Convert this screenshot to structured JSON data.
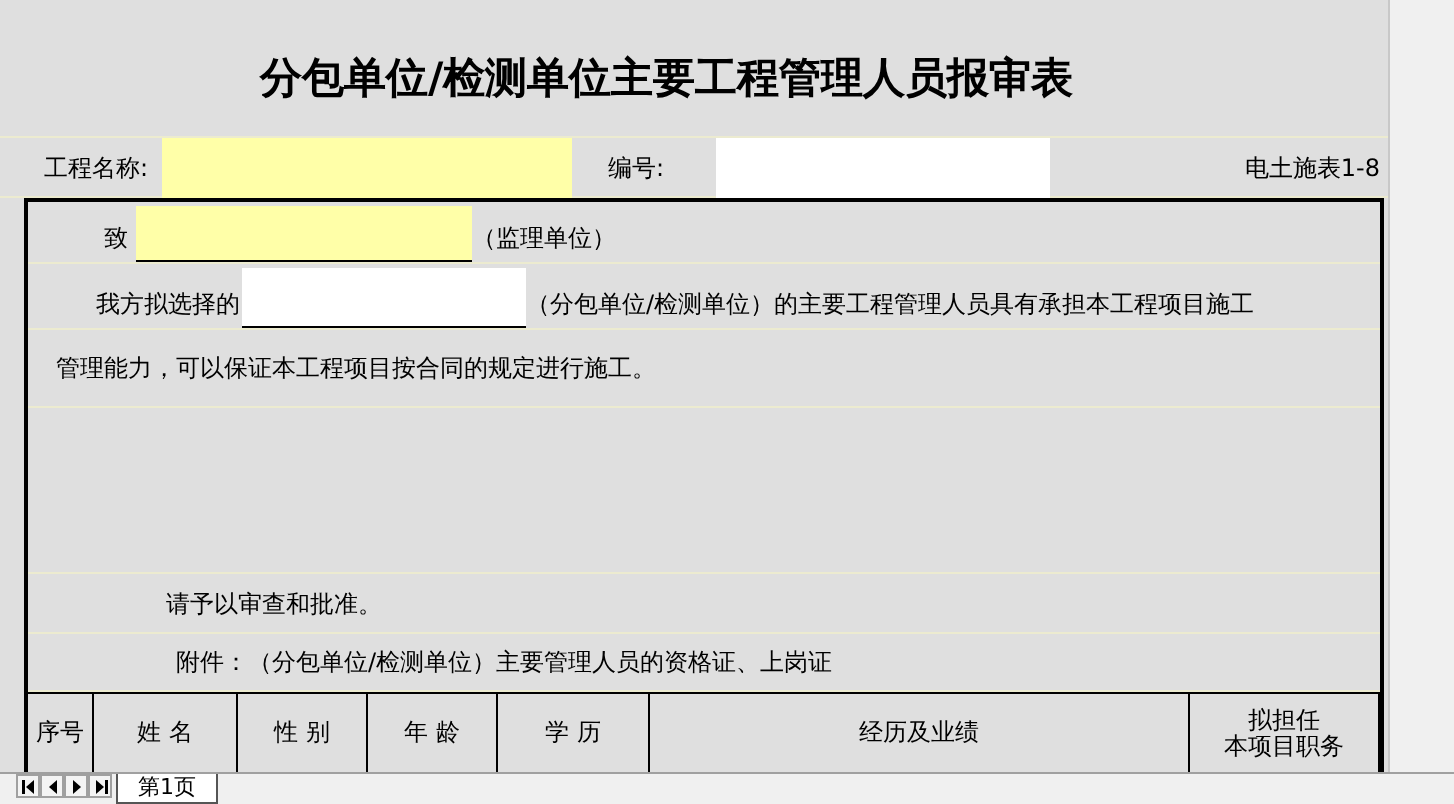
{
  "title": "分包单位/检测单位主要工程管理人员报审表",
  "header": {
    "project_label": "工程名称:",
    "number_label": "编号:",
    "form_code": "电土施表1-8"
  },
  "body": {
    "to_label": "致",
    "to_suffix": "（监理单位）",
    "line1_prefix": "我方拟选择的",
    "line1_suffix": "（分包单位/检测单位）的主要工程管理人员具有承担本工程项目施工",
    "line2": "管理能力，可以保证本工程项目按合同的规定进行施工。",
    "request": "请予以审查和批准。",
    "attachment": "附件：（分包单位/检测单位）主要管理人员的资格证、上岗证"
  },
  "table": {
    "columns": [
      {
        "lines": [
          "序号"
        ]
      },
      {
        "lines": [
          "姓 名"
        ]
      },
      {
        "lines": [
          "性 别"
        ]
      },
      {
        "lines": [
          "年 龄"
        ]
      },
      {
        "lines": [
          "学 历"
        ]
      },
      {
        "lines": [
          "经历及业绩"
        ]
      },
      {
        "lines": [
          "拟担任",
          "本项目职务"
        ]
      }
    ]
  },
  "sheet_tabs": [
    {
      "label": "第1页",
      "selected": true
    }
  ]
}
